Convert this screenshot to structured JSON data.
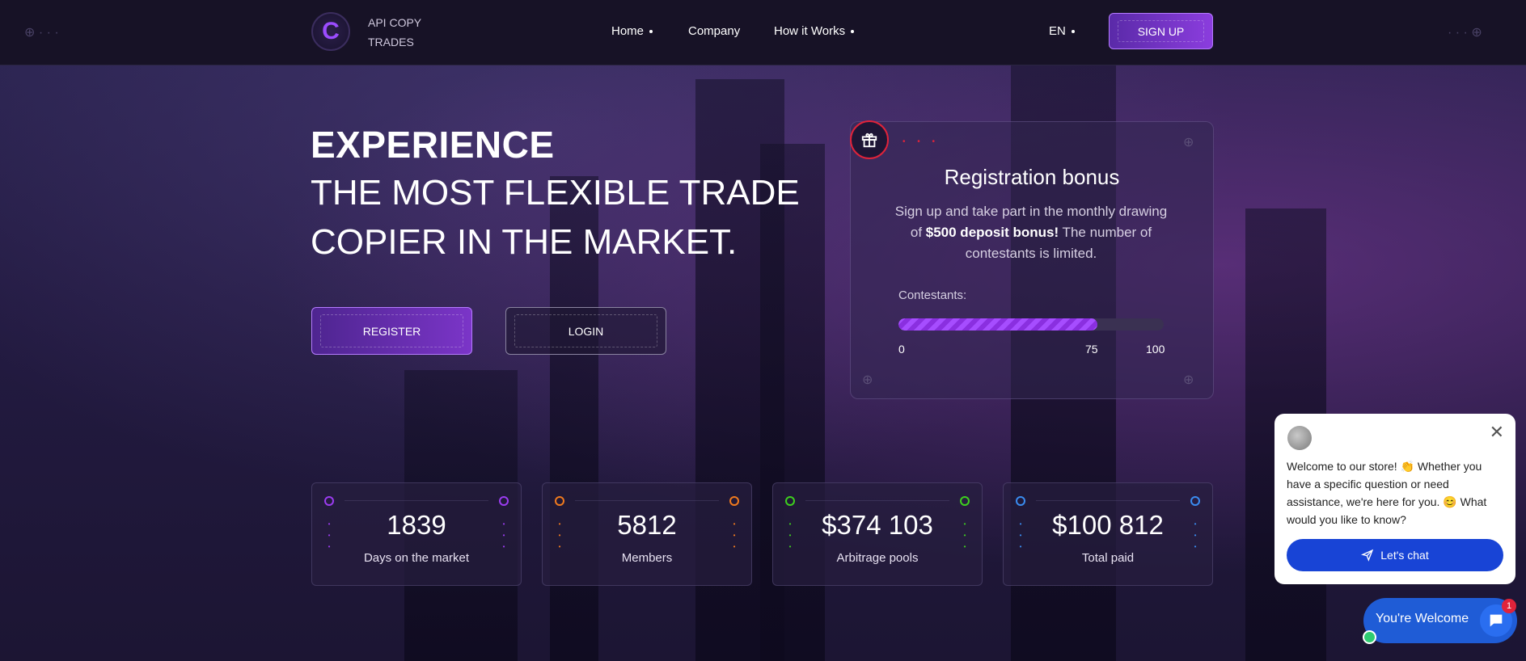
{
  "header": {
    "logo_letter": "C",
    "brand_line1": "API COPY",
    "brand_line2": "TRADES",
    "nav": [
      {
        "label": "Home",
        "has_dropdown": true
      },
      {
        "label": "Company",
        "has_dropdown": false
      },
      {
        "label": "How it Works",
        "has_dropdown": true
      }
    ],
    "language": "EN",
    "signup_label": "SIGN UP"
  },
  "hero": {
    "line1": "EXPERIENCE",
    "line2": "THE MOST FLEXIBLE TRADE",
    "line3": "COPIER IN THE MARKET.",
    "register_label": "REGISTER",
    "login_label": "LOGIN"
  },
  "bonus": {
    "title": "Registration bonus",
    "desc_pre": "Sign up and take part in the monthly drawing of ",
    "desc_bold": "$500 deposit bonus!",
    "desc_post": " The number of contestants is limited.",
    "contestants_label": "Contestants:",
    "progress_value": 75,
    "progress_max": 100,
    "ticks": [
      "0",
      "75",
      "100"
    ]
  },
  "stats": [
    {
      "value": "1839",
      "label": "Days on the market",
      "color": "#9b3cf0"
    },
    {
      "value": "5812",
      "label": "Members",
      "color": "#f07a1e"
    },
    {
      "value": "$374 103",
      "label": "Arbitrage pools",
      "color": "#3ed01e"
    },
    {
      "value": "$100 812",
      "label": "Total paid",
      "color": "#3a8cf0"
    }
  ],
  "chat": {
    "message": "Welcome to our store! 👏 Whether you have a specific question or need assistance, we're here for you. 😊 What would you like to know?",
    "button_label": "Let's chat",
    "launcher_label": "You're Welcome",
    "badge_count": "1"
  },
  "colors": {
    "accent": "#9b4cff",
    "gift_ring": "#e0233a",
    "chat_button": "#1844d6"
  }
}
